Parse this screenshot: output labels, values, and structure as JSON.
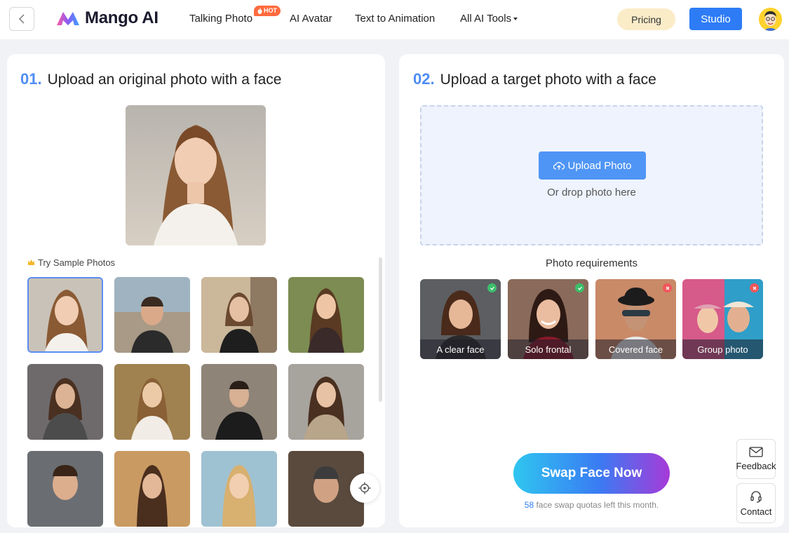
{
  "header": {
    "brand": "Mango AI",
    "nav": [
      {
        "label": "Talking Photo",
        "badge": "HOT"
      },
      {
        "label": "AI Avatar"
      },
      {
        "label": "Text to Animation"
      },
      {
        "label": "All AI Tools"
      }
    ],
    "pricing_label": "Pricing",
    "studio_label": "Studio"
  },
  "left_panel": {
    "step_number": "01.",
    "title": "Upload an original photo with a face",
    "sample_label": "Try Sample Photos",
    "sample_count": 12,
    "selected_sample_index": 0
  },
  "right_panel": {
    "step_number": "02.",
    "title": "Upload a target photo with a face",
    "upload_label": "Upload Photo",
    "drop_text": "Or drop photo here",
    "requirements_title": "Photo requirements",
    "requirements": [
      {
        "label": "A clear face",
        "status": "ok"
      },
      {
        "label": "Solo frontal",
        "status": "ok"
      },
      {
        "label": "Covered face",
        "status": "bad"
      },
      {
        "label": "Group photo",
        "status": "bad"
      }
    ],
    "swap_label": "Swap Face Now",
    "quota_count": "58",
    "quota_text": " face swap quotas left this month."
  },
  "side": {
    "feedback_label": "Feedback",
    "contact_label": "Contact"
  },
  "colors": {
    "accent": "#2d7cf6",
    "step_number": "#4f8df5",
    "pricing_bg": "#fbecc8",
    "ok": "#3cbf6a",
    "bad": "#f0565a"
  }
}
